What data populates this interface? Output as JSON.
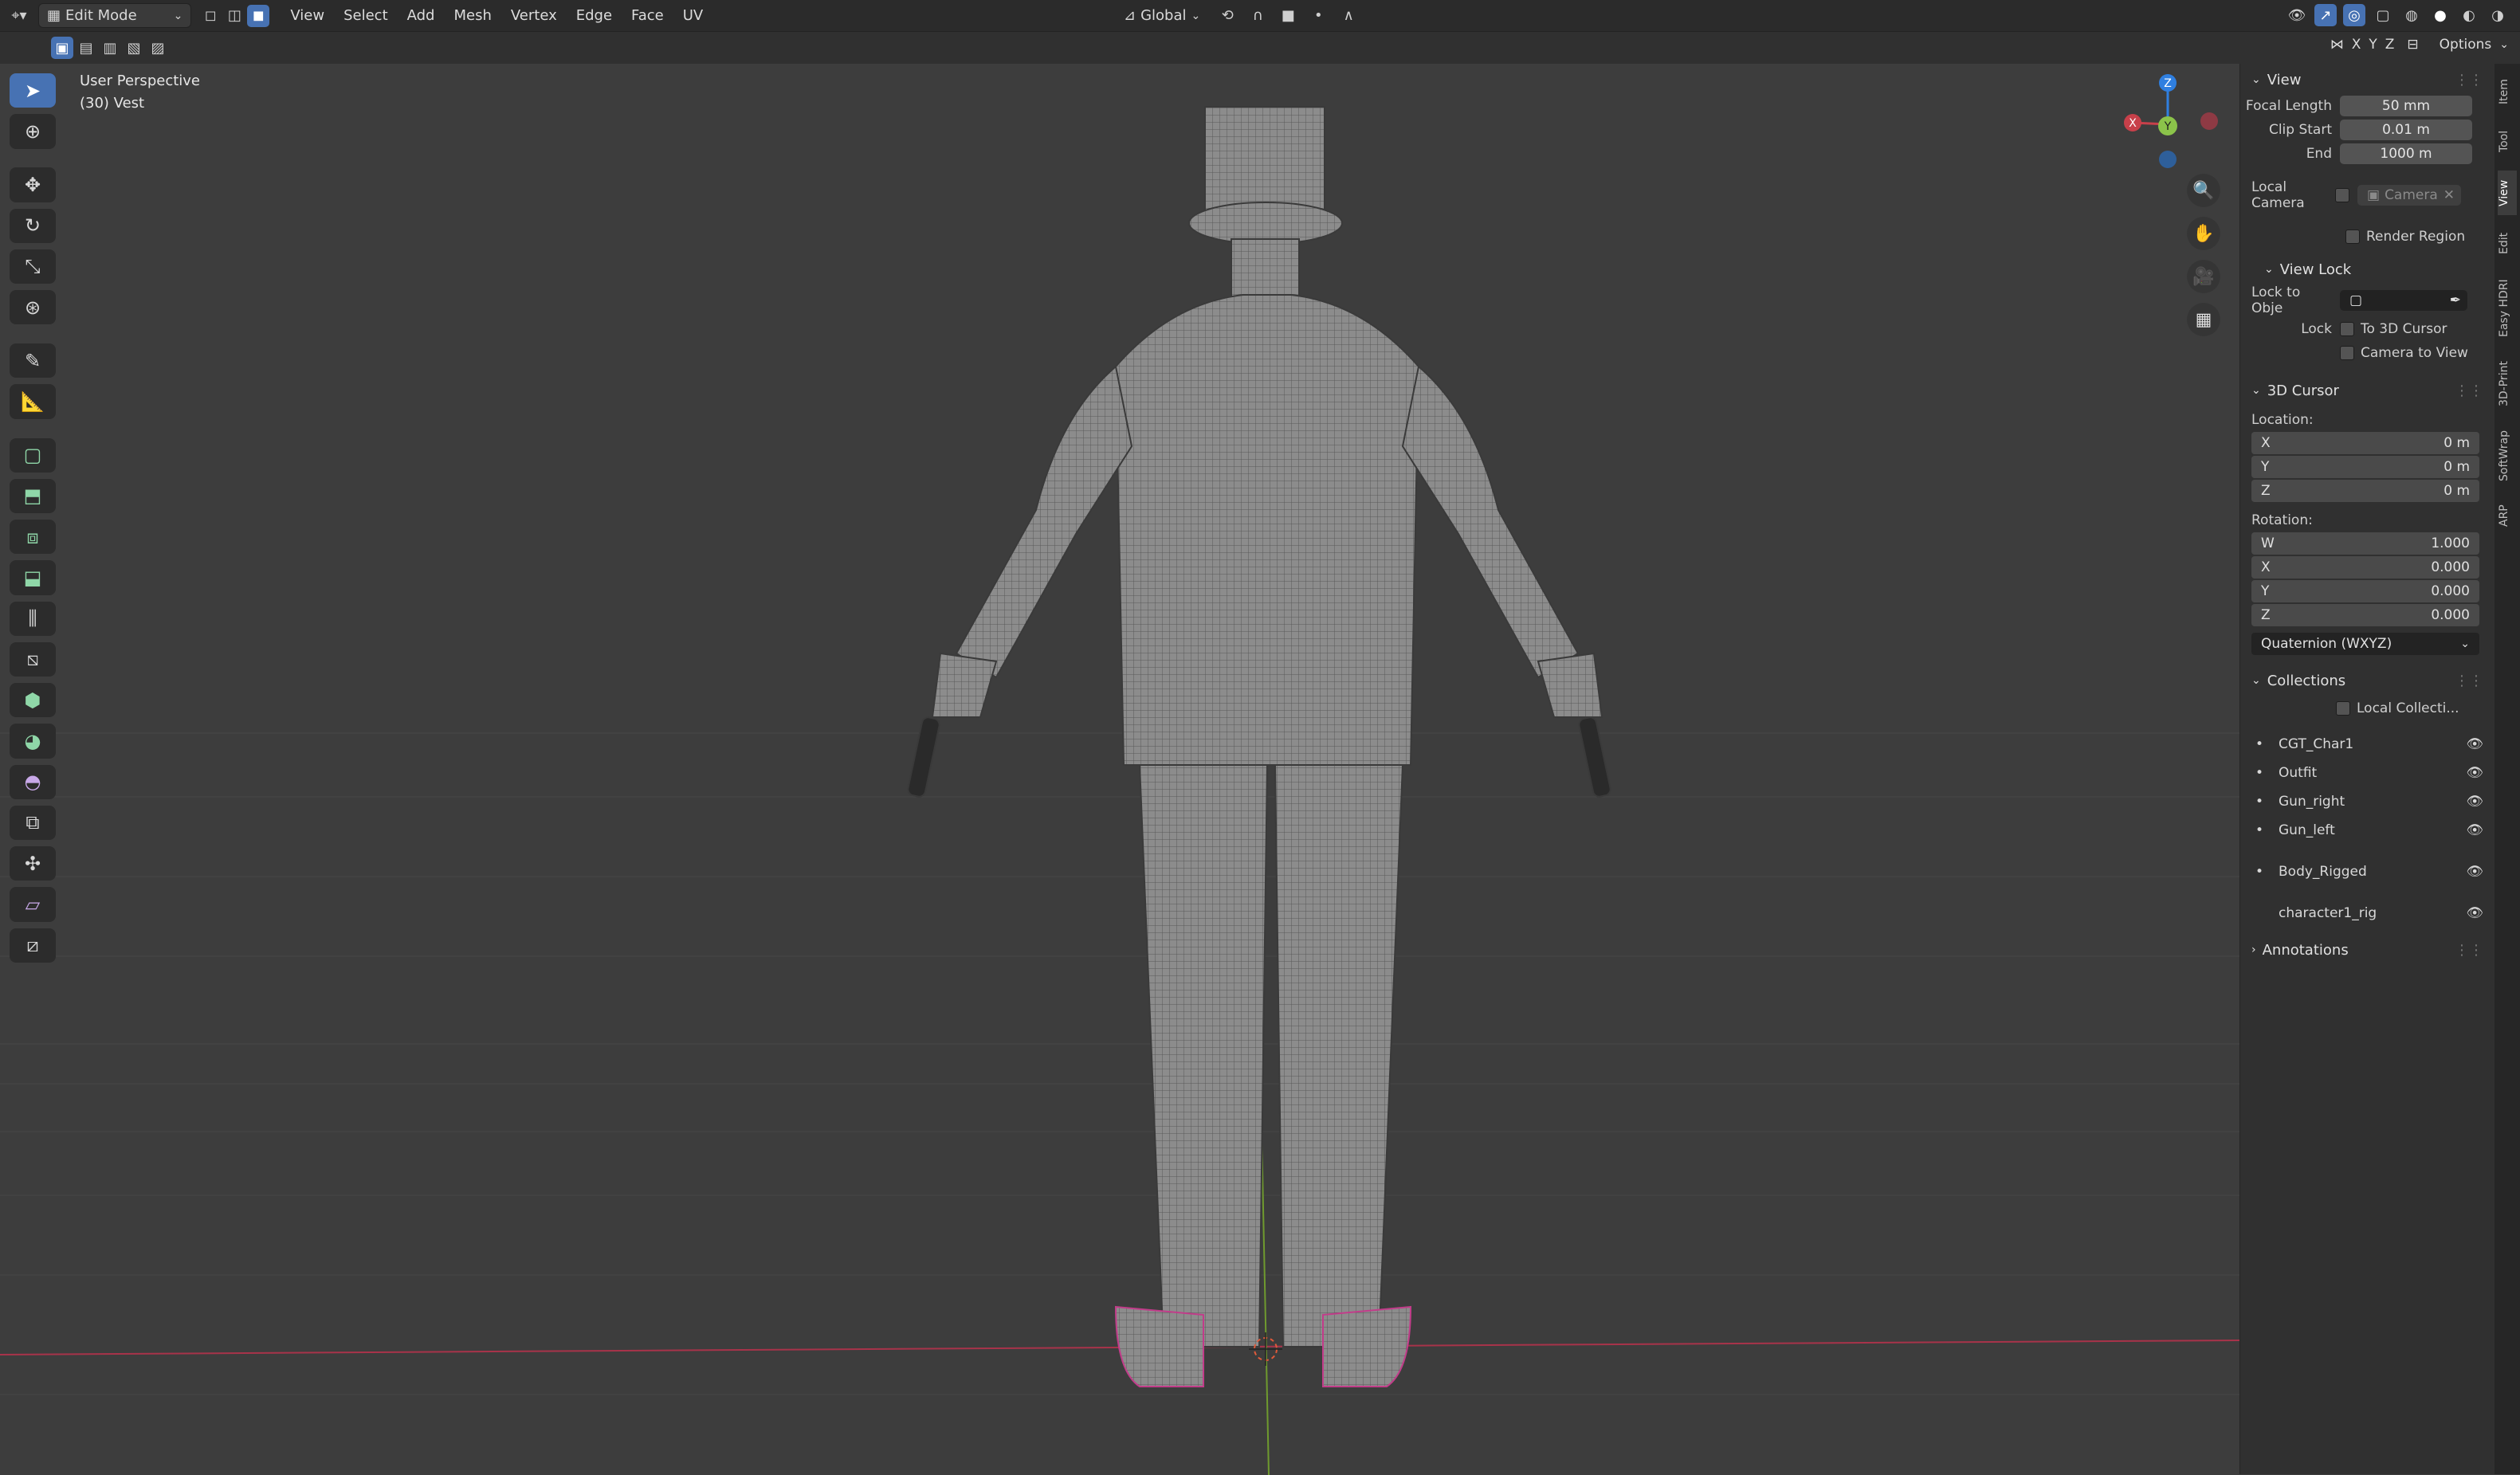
{
  "topbar": {
    "mode": "Edit Mode",
    "menus": [
      "View",
      "Select",
      "Add",
      "Mesh",
      "Vertex",
      "Edge",
      "Face",
      "UV"
    ],
    "transform_orientation": "Global",
    "options_label": "Options",
    "axis_labels": [
      "X",
      "Y",
      "Z"
    ]
  },
  "viewport": {
    "view_name": "User Perspective",
    "object_name": "(30) Vest"
  },
  "gizmo": {
    "z": "Z",
    "y": "Y",
    "x": "X"
  },
  "sidebar": {
    "view_panel": {
      "title": "View",
      "focal_length_label": "Focal Length",
      "focal_length": "50 mm",
      "clip_start_label": "Clip Start",
      "clip_start": "0.01 m",
      "end_label": "End",
      "end": "1000 m",
      "local_camera_label": "Local Camera",
      "camera_name": "Camera",
      "render_region_label": "Render Region"
    },
    "view_lock": {
      "title": "View Lock",
      "lock_to_object_label": "Lock to Obje",
      "lock_label": "Lock",
      "to_3d_cursor_label": "To 3D Cursor",
      "camera_to_view_label": "Camera to View"
    },
    "cursor_panel": {
      "title": "3D Cursor",
      "location_label": "Location:",
      "location": [
        {
          "axis": "X",
          "value": "0 m"
        },
        {
          "axis": "Y",
          "value": "0 m"
        },
        {
          "axis": "Z",
          "value": "0 m"
        }
      ],
      "rotation_label": "Rotation:",
      "rotation": [
        {
          "axis": "W",
          "value": "1.000"
        },
        {
          "axis": "X",
          "value": "0.000"
        },
        {
          "axis": "Y",
          "value": "0.000"
        },
        {
          "axis": "Z",
          "value": "0.000"
        }
      ],
      "rotation_mode": "Quaternion (WXYZ)"
    },
    "collections_panel": {
      "title": "Collections",
      "local_collections_label": "Local Collecti...",
      "items": [
        "CGT_Char1",
        "Outfit",
        "Gun_right",
        "Gun_left",
        "Body_Rigged",
        "character1_rig"
      ]
    },
    "annotations_panel": {
      "title": "Annotations"
    }
  },
  "sidetabs": [
    "Item",
    "Tool",
    "View",
    "Edit",
    "Easy HDRI",
    "3D-Print",
    "SoftWrap",
    "ARP"
  ],
  "colors": {
    "accent": "#4772b3",
    "background": "#3d3d3d",
    "x_axis": "#c8404a",
    "y_axis": "#8bc34a",
    "z_axis": "#2f7fe0"
  }
}
